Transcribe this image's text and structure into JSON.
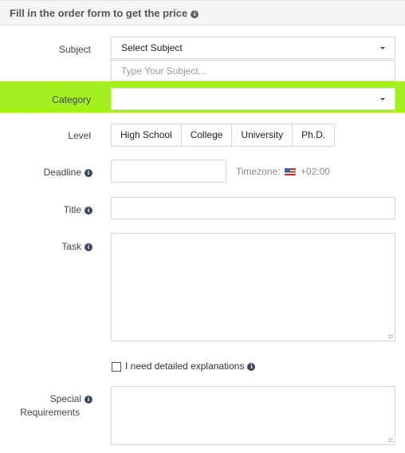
{
  "header": {
    "title": "Fill in the order form to get the price",
    "info_icon": "info-circle-icon"
  },
  "fields": {
    "subject": {
      "label": "Subject",
      "select_value": "Select Subject",
      "input_placeholder": "Type Your Subject..."
    },
    "category": {
      "label": "Category",
      "select_value": "",
      "highlight_color": "#a3f020"
    },
    "level": {
      "label": "Level",
      "options": [
        "High School",
        "College",
        "University",
        "Ph.D."
      ]
    },
    "deadline": {
      "label": "Deadline",
      "value": "",
      "timezone_label": "Timezone:",
      "timezone_flag": "us-flag-icon",
      "timezone_value": "+02:00"
    },
    "title": {
      "label": "Title",
      "value": ""
    },
    "task": {
      "label": "Task",
      "value": ""
    },
    "explanations": {
      "label": "I need detailed explanations",
      "checked": false
    },
    "special": {
      "label_line1": "Special",
      "label_line2": "Requirements",
      "value": ""
    }
  },
  "info_glyph": "i"
}
